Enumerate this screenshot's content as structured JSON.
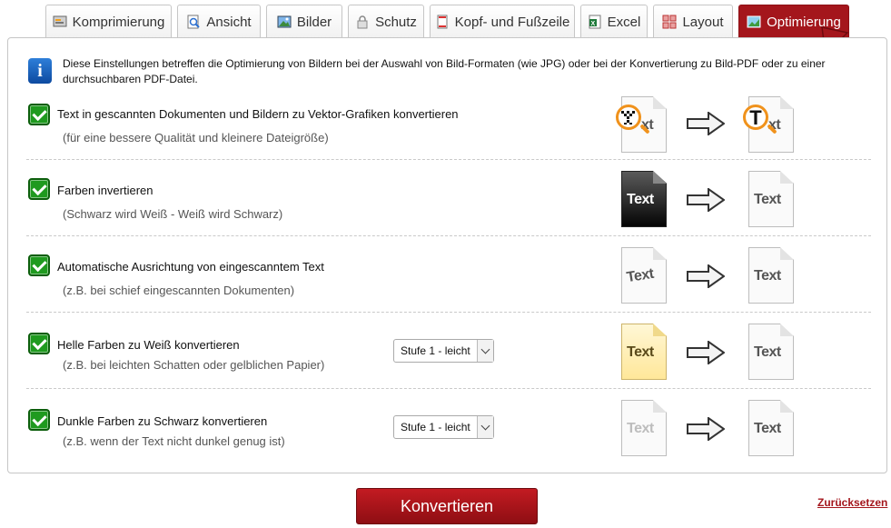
{
  "tabs": [
    {
      "label": "Komprimierung",
      "icon": "compress-icon",
      "active": false
    },
    {
      "label": "Ansicht",
      "icon": "view-icon",
      "active": false
    },
    {
      "label": "Bilder",
      "icon": "image-icon",
      "active": false
    },
    {
      "label": "Schutz",
      "icon": "lock-icon",
      "active": false
    },
    {
      "label": "Kopf- und Fußzeile",
      "icon": "header-footer-icon",
      "active": false
    },
    {
      "label": "Excel",
      "icon": "excel-icon",
      "active": false
    },
    {
      "label": "Layout",
      "icon": "layout-icon",
      "active": false
    },
    {
      "label": "Optimierung",
      "icon": "optimize-icon",
      "active": true
    }
  ],
  "info": {
    "text": "Diese Einstellungen betreffen die Optimierung von Bildern bei der Auswahl von Bild-Formaten (wie JPG) oder bei der Konvertierung zu Bild-PDF oder zu einer durchsuchbaren PDF-Datei."
  },
  "options": [
    {
      "label": "Text in gescannten Dokumenten und Bildern zu Vektor-Grafiken konvertieren",
      "sub": "(für eine bessere Qualität und kleinere Dateigröße)",
      "checked": true,
      "before_text": "xt",
      "after_text": "xt"
    },
    {
      "label": "Farben invertieren",
      "sub": "(Schwarz wird Weiß - Weiß wird Schwarz)",
      "checked": true,
      "before_text": "Text",
      "after_text": "Text"
    },
    {
      "label": "Automatische Ausrichtung von eingescanntem Text",
      "sub": "(z.B. bei schief eingescannten Dokumenten)",
      "checked": true,
      "before_text": "Text",
      "after_text": "Text"
    },
    {
      "label": "Helle Farben zu Weiß konvertieren",
      "sub": "(z.B. bei leichten Schatten oder gelblichen Papier)",
      "checked": true,
      "select": "Stufe 1 - leicht",
      "before_text": "Text",
      "after_text": "Text"
    },
    {
      "label": "Dunkle Farben zu Schwarz konvertieren",
      "sub": "(z.B. wenn der Text nicht dunkel genug ist)",
      "checked": true,
      "select": "Stufe 1 - leicht",
      "before_text": "Text",
      "after_text": "Text"
    }
  ],
  "magnifier_letter": "T",
  "buttons": {
    "convert": "Konvertieren",
    "reset": "Zurücksetzen"
  },
  "colors": {
    "accent": "#a4161c",
    "checkbox": "#1f9a1f",
    "info": "#1a5fbf"
  }
}
